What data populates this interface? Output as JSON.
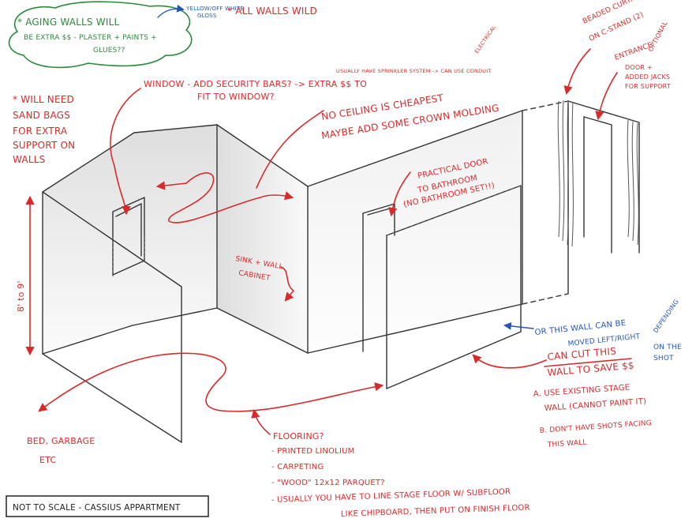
{
  "notes": {
    "aging_1": "* AGING WALLS WILL",
    "aging_2": "BE EXTRA $$ - PLASTER + PAINTS +",
    "aging_3": "GLUES??",
    "yellow_1": "YELLOW/OFF WHITE",
    "yellow_2": "GLOSS",
    "all_walls": "* ALL WALLS WILD",
    "sandbags_1": "* WILL NEED",
    "sandbags_2": "SAND BAGS",
    "sandbags_3": "FOR EXTRA",
    "sandbags_4": "SUPPORT ON",
    "sandbags_5": "WALLS",
    "window_1": "WINDOW - ADD SECURITY BARS? -> EXTRA $$ TO",
    "window_2": "FIT TO WINDOW?",
    "sprinkler_1": "USUALLY HAVE SPRINKLER SYSTEM -> CAN USE CONDUIT",
    "electrical_1": "ELECTRICAL",
    "ceiling_1": "NO CEILING IS CHEAPEST",
    "ceiling_2": "MAYBE ADD SOME CROWN MOLDING",
    "curtains_1": "BEADED CURTAINS",
    "curtains_2": "ON C-STAND (2)",
    "entrance_1": "OPTIONAL",
    "entrance_2": "ENTRANCE",
    "entrance_3": "DOOR +",
    "entrance_4": "ADDED JACKS",
    "entrance_5": "FOR SUPPORT",
    "door_1": "PRACTICAL DOOR",
    "door_2": "TO BATHROOM",
    "door_3": "(NO BATHROOM SET!!)",
    "sink_1": "SINK + WALL",
    "sink_2": "CABINET",
    "height": "8' to 9'",
    "moved_1": "OR THIS WALL CAN BE",
    "moved_2": "MOVED LEFT/RIGHT",
    "depending_1": "DEPENDING",
    "depending_2": "ON THE",
    "depending_3": "SHOT",
    "cancut_1": "CAN CUT THIS",
    "cancut_2": "WALL TO SAVE $$",
    "opt_a_1": "A. USE EXISTING STAGE",
    "opt_a_2": "WALL (CANNOT PAINT IT)",
    "opt_b_1": "B. DON'T HAVE SHOTS FACING",
    "opt_b_2": "THIS WALL",
    "bed_1": "BED, GARBAGE",
    "bed_2": "ETC",
    "floor_1": "FLOORING?",
    "floor_2": "- PRINTED LINOLIUM",
    "floor_3": "- CARPETING",
    "floor_4": "- \"WOOD\" 12x12 PARQUET?",
    "floor_5": "- USUALLY YOU HAVE TO LINE STAGE FLOOR W/ SUBFLOOR",
    "floor_6": "LIKE CHIPBOARD, THEN PUT ON FINISH FLOOR",
    "footer": "NOT TO SCALE - CASSIUS APPARTMENT"
  },
  "colors": {
    "red": "#d82a2a",
    "green": "#2a8a3a",
    "blue": "#2457b8",
    "ink": "#333333"
  }
}
